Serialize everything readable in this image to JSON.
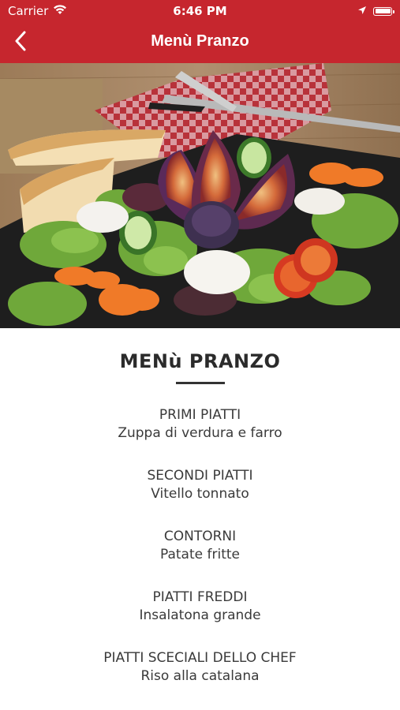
{
  "status_bar": {
    "carrier": "Carrier",
    "time": "6:46 PM",
    "wifi_icon": "wifi-icon",
    "location_icon": "location-arrow-icon",
    "battery_icon": "battery-icon"
  },
  "nav": {
    "title": "Menù Pranzo",
    "back_icon": "chevron-left-icon",
    "bar_color": "#c6262e"
  },
  "hero": {
    "image": "salad-with-figs-photo"
  },
  "menu": {
    "title": "MENù PRANZO",
    "sections": [
      {
        "category": "PRIMI PIATTI",
        "dish": "Zuppa di verdura e farro"
      },
      {
        "category": "SECONDI PIATTI",
        "dish": "Vitello tonnato"
      },
      {
        "category": "CONTORNI",
        "dish": "Patate fritte"
      },
      {
        "category": "PIATTI FREDDI",
        "dish": "Insalatona grande"
      },
      {
        "category": "PIATTI SCECIALI DELLO CHEF",
        "dish": "Riso alla catalana"
      }
    ]
  }
}
